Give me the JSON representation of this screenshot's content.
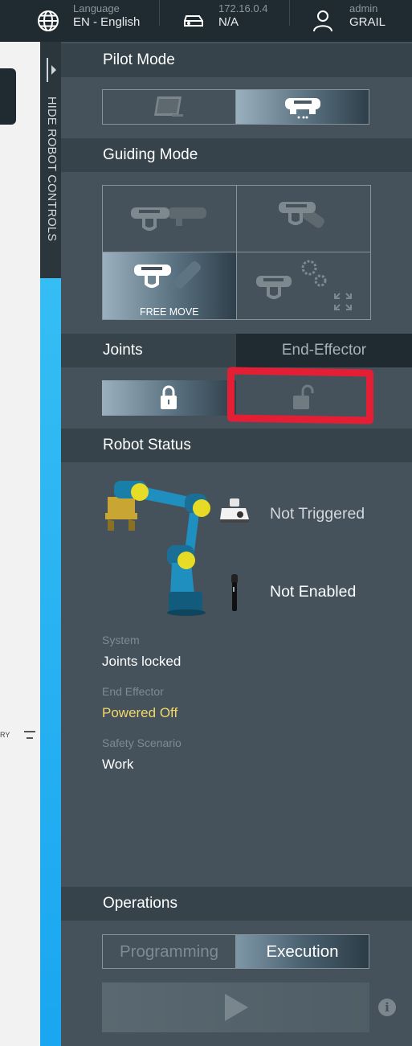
{
  "header": {
    "language": {
      "label": "Language",
      "value": "EN - English",
      "icon": "globe-icon"
    },
    "network": {
      "ip": "172.16.0.4",
      "value": "N/A",
      "icon": "network-device-icon"
    },
    "user": {
      "role": "admin",
      "name": "GRAIL",
      "icon": "user-icon"
    }
  },
  "left_panel": {
    "filter_text": "RY",
    "filter_icon": "filter-icon"
  },
  "hide_controls": {
    "label": "HIDE ROBOT CONTROLS"
  },
  "pilot_mode": {
    "title": "Pilot Mode",
    "options": [
      {
        "icon": "tablet-icon",
        "selected": false
      },
      {
        "icon": "pilot-gripper-icon",
        "selected": true
      }
    ]
  },
  "guiding_mode": {
    "title": "Guiding Mode",
    "options": [
      {
        "icon": "translation-mode-icon",
        "selected": false,
        "label": ""
      },
      {
        "icon": "rotation-mode-icon",
        "selected": false,
        "label": ""
      },
      {
        "icon": "free-move-icon",
        "selected": true,
        "label": "FREE MOVE"
      },
      {
        "icon": "user-defined-mode-icon",
        "selected": false,
        "label": ""
      }
    ]
  },
  "tabs": {
    "joints": "Joints",
    "end_effector": "End-Effector",
    "active": "joints"
  },
  "joints_lock": {
    "options": [
      {
        "icon": "lock-closed-icon",
        "selected": true
      },
      {
        "icon": "lock-open-icon",
        "selected": false
      }
    ]
  },
  "robot_status": {
    "title": "Robot Status",
    "external_activation": "Not Triggered",
    "enabling_device": "Not Enabled",
    "system_label": "System",
    "system_value": "Joints locked",
    "end_effector_label": "End Effector",
    "end_effector_value": "Powered Off",
    "safety_label": "Safety Scenario",
    "safety_value": "Work"
  },
  "operations": {
    "title": "Operations",
    "programming": "Programming",
    "execution": "Execution",
    "active": "execution"
  },
  "colors": {
    "header_bg": "#1f2a31",
    "panel_bg": "#46525b",
    "section_bg": "#37434b",
    "warning": "#f2d86b",
    "highlight_red": "#e41f35",
    "accent_blue": "#1aa6f0"
  }
}
